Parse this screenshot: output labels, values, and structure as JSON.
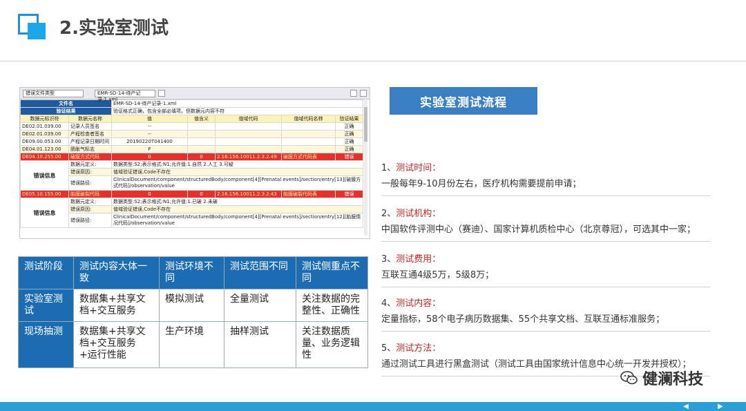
{
  "header": {
    "title": "2.实验室测试"
  },
  "screenshot": {
    "toolbar": {
      "dropdown1": "错误文件类型",
      "dropdown2": "EMR-SD-14-待产记录-1.xml"
    },
    "file_label": "文件名",
    "file_value": "EMR-SD-14-待产记录-1.xml",
    "verify_label": "验证结果",
    "verify_value": "验证格式正确，包含全部必填项，但数据元内容不符",
    "columns": [
      "数据元标识符",
      "数据元名称",
      "值",
      "值含义",
      "值域代码",
      "值域代码名称",
      "验证结果"
    ],
    "rows": [
      {
        "id": "DE02.01.039.00",
        "name": "记录人员签名",
        "value": "--",
        "meaning": "",
        "code": "",
        "code_name": "",
        "result": "正确"
      },
      {
        "id": "DE02.01.039.00",
        "name": "产程检查者签名",
        "value": "--",
        "meaning": "",
        "code": "",
        "code_name": "",
        "result": "正确"
      },
      {
        "id": "DE09.00.053.00",
        "name": "产程记录日期时间",
        "value": "20190220T041400",
        "meaning": "",
        "code": "",
        "code_name": "",
        "result": "正确"
      },
      {
        "id": "DE04.01.123.00",
        "name": "肠胀气标志",
        "value": "F",
        "meaning": "",
        "code": "",
        "code_name": "",
        "result": "正确"
      }
    ],
    "error1": {
      "row": {
        "id": "DE04.10.255.00",
        "name": "破膜方式代码",
        "value": "0",
        "meaning": "0",
        "code": "2.16.156.10011.2.3.2.49",
        "code_name": "破膜方式代码表",
        "result": "错误"
      },
      "label": "错误信息",
      "def_label": "数据元定义:",
      "def_value": "数据类型:S2;表示格式:N1;允许值:1.自然 2.人工 3.可疑",
      "cause_label": "错误原因:",
      "cause_value": "值域验证错误,Code不存在",
      "path_label": "错误路径:",
      "path_value": "ClinicalDocument/component/structuredBody/component[4][Prenatal events]/section/entry[13][破膜方式代码]/observation/value"
    },
    "error2": {
      "row": {
        "id": "DE05.10.155.00",
        "name": "胎膜破裂代码",
        "value": "0",
        "meaning": "0",
        "code": "2.16.156.10011.2.3.2.43",
        "code_name": "胎膜破裂代码表",
        "result": "错误"
      },
      "label": "错误信息",
      "def_label": "数据元定义:",
      "def_value": "数据类型:S2;表示格式:N1;允许值:1.已破 2.未破",
      "cause_label": "错误原因:",
      "cause_value": "值域验证错误,Code不存在",
      "path_label": "错误路径:",
      "path_value": "ClinicalDocument/component/structuredBody/component[4][Prenatal events]/section/entry[12][胎膜情况代码]/observation/value"
    }
  },
  "stage_table": {
    "headers": [
      "测试阶段",
      "测试内容大体一致",
      "测试环境不同",
      "测试范围不同",
      "测试侧重点不同"
    ],
    "rows": [
      {
        "stage": "实验室测试",
        "content": "数据集+共享文档+交互服务",
        "env": "模拟测试",
        "scope": "全量测试",
        "focus": "关注数据的完整性、正确性"
      },
      {
        "stage": "现场抽测",
        "content": "数据集+共享文档+交互服务+运行性能",
        "env": "生产环境",
        "scope": "抽样测试",
        "focus": "关注数据质量、业务逻辑性"
      }
    ]
  },
  "flow": {
    "button": "实验室测试流程",
    "items": [
      {
        "num": "1、",
        "title": "测试时间：",
        "body": "一般每年9-10月份左右，医疗机构需要提前申请；"
      },
      {
        "num": "2、",
        "title": "测试机构：",
        "body": "中国软件评测中心（赛迪）、国家计算机质检中心（北京尊冠），可选其中一家；"
      },
      {
        "num": "3、",
        "title": "测试费用：",
        "body": "互联互通4级5万，5级8万；"
      },
      {
        "num": "4、",
        "title": "测试内容：",
        "body": "定量指标，58个电子病历数据集、55个共享文档、互联互通标准服务；"
      },
      {
        "num": "5、",
        "title": "测试方法：",
        "body": "通过测试工具进行黑盒测试（测试工具由国家统计信息中心统一开发并授权）；"
      }
    ]
  },
  "watermark": {
    "text": "健澜科技"
  },
  "footer": {
    "prev": "◀",
    "next": "▶"
  }
}
